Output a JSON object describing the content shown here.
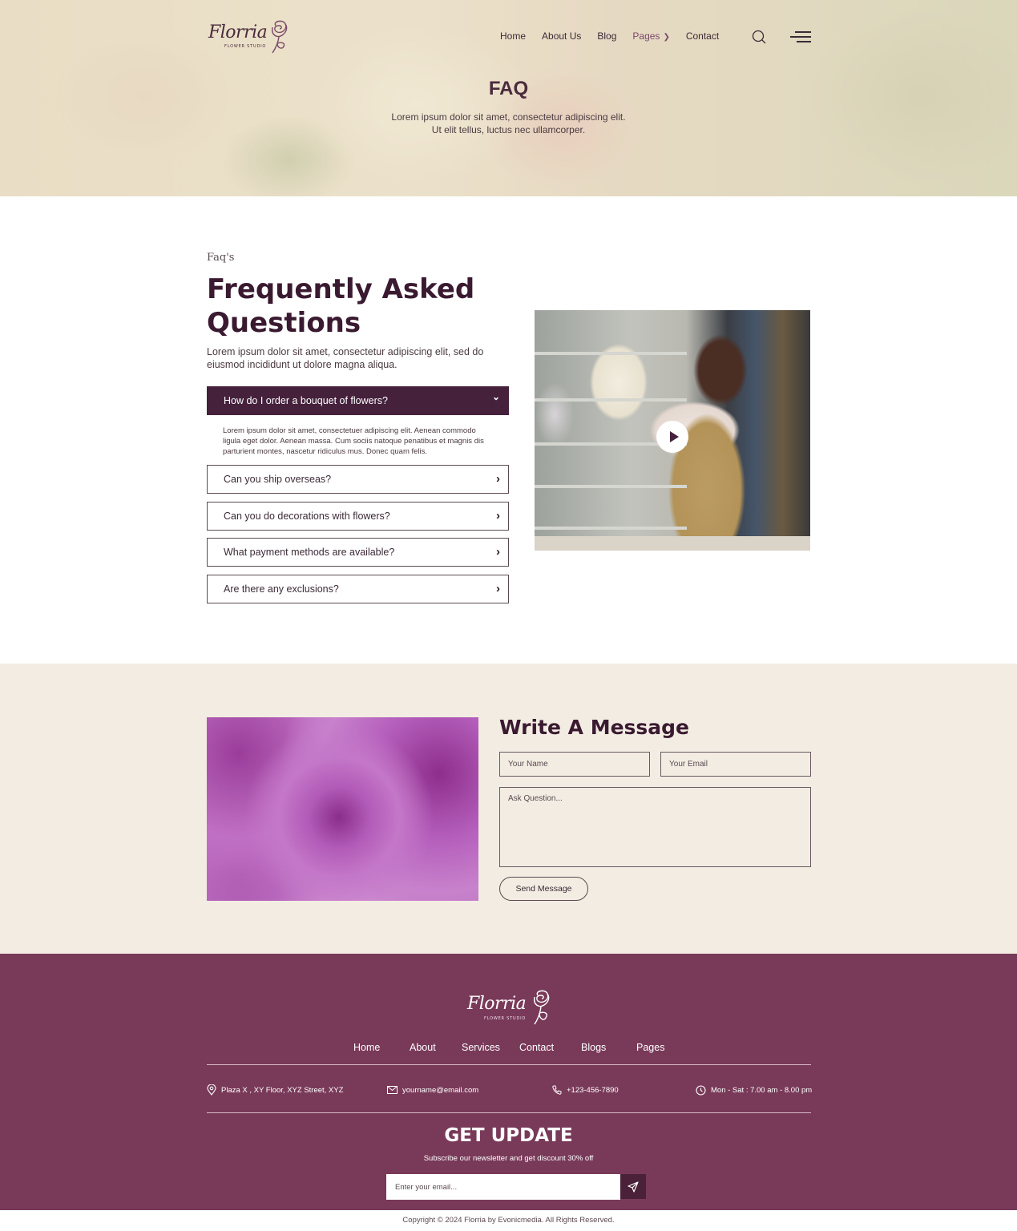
{
  "brand": {
    "name": "Florria",
    "tagline": "FLOWER STUDIO"
  },
  "nav": {
    "items": [
      {
        "label": "Home"
      },
      {
        "label": "About Us"
      },
      {
        "label": "Blog"
      },
      {
        "label": "Pages",
        "has_dropdown": true,
        "dropdown_icon": "chevron-down-icon"
      },
      {
        "label": "Contact"
      }
    ],
    "search_icon": "search-icon",
    "menu_icon": "hamburger-menu-icon"
  },
  "hero": {
    "title": "FAQ",
    "subtitle_line1": "Lorem ipsum dolor sit amet, consectetur adipiscing elit.",
    "subtitle_line2": "Ut elit tellus, luctus nec ullamcorper."
  },
  "faq": {
    "eyebrow": "Faq's",
    "title": "Frequently Asked Questions",
    "lead": "Lorem ipsum dolor sit amet, consectetur adipiscing elit, sed do eiusmod incididunt ut dolore magna aliqua.",
    "items": [
      {
        "question": "How do I order a bouquet of flowers?",
        "open": true,
        "icon": "chevron-down-icon",
        "answer": "Lorem ipsum dolor sit amet, consectetuer adipiscing elit. Aenean commodo ligula eget dolor. Aenean massa. Cum sociis natoque penatibus et magnis dis parturient montes, nascetur ridiculus mus. Donec quam felis."
      },
      {
        "question": "Can you ship overseas?",
        "open": false,
        "icon": "chevron-right-icon"
      },
      {
        "question": "Can you do decorations with flowers?",
        "open": false,
        "icon": "chevron-right-icon"
      },
      {
        "question": "What payment methods are available?",
        "open": false,
        "icon": "chevron-right-icon"
      },
      {
        "question": "Are there any exclusions?",
        "open": false,
        "icon": "chevron-right-icon"
      }
    ],
    "video": {
      "play_icon": "play-icon"
    }
  },
  "contact_form": {
    "title": "Write A Message",
    "name_placeholder": "Your Name",
    "email_placeholder": "Your Email",
    "question_placeholder": "Ask Question...",
    "submit_label": "Send Message"
  },
  "footer": {
    "nav": [
      {
        "label": "Home"
      },
      {
        "label": "About"
      },
      {
        "label": "Services"
      },
      {
        "label": "Contact"
      },
      {
        "label": "Blogs"
      },
      {
        "label": "Pages"
      }
    ],
    "info": {
      "address": "Plaza X , XY Floor, XYZ Street, XYZ",
      "email": "yourname@email.com",
      "phone": "+123-456-7890",
      "hours": "Mon - Sat : 7.00 am - 8.00 pm"
    },
    "newsletter": {
      "title": "GET UPDATE",
      "subtitle": "Subscribe our newsletter and get discount 30% off",
      "placeholder": "Enter your email...",
      "submit_icon": "send-paper-plane-icon"
    },
    "copyright": "Copyright © 2024 Florria by Evonicmedia. All Rights Reserved."
  },
  "colors": {
    "primary_dark": "#45213c",
    "footer_bg": "#793a59",
    "contact_bg": "#f2ece3",
    "heading": "#3a1a30"
  }
}
